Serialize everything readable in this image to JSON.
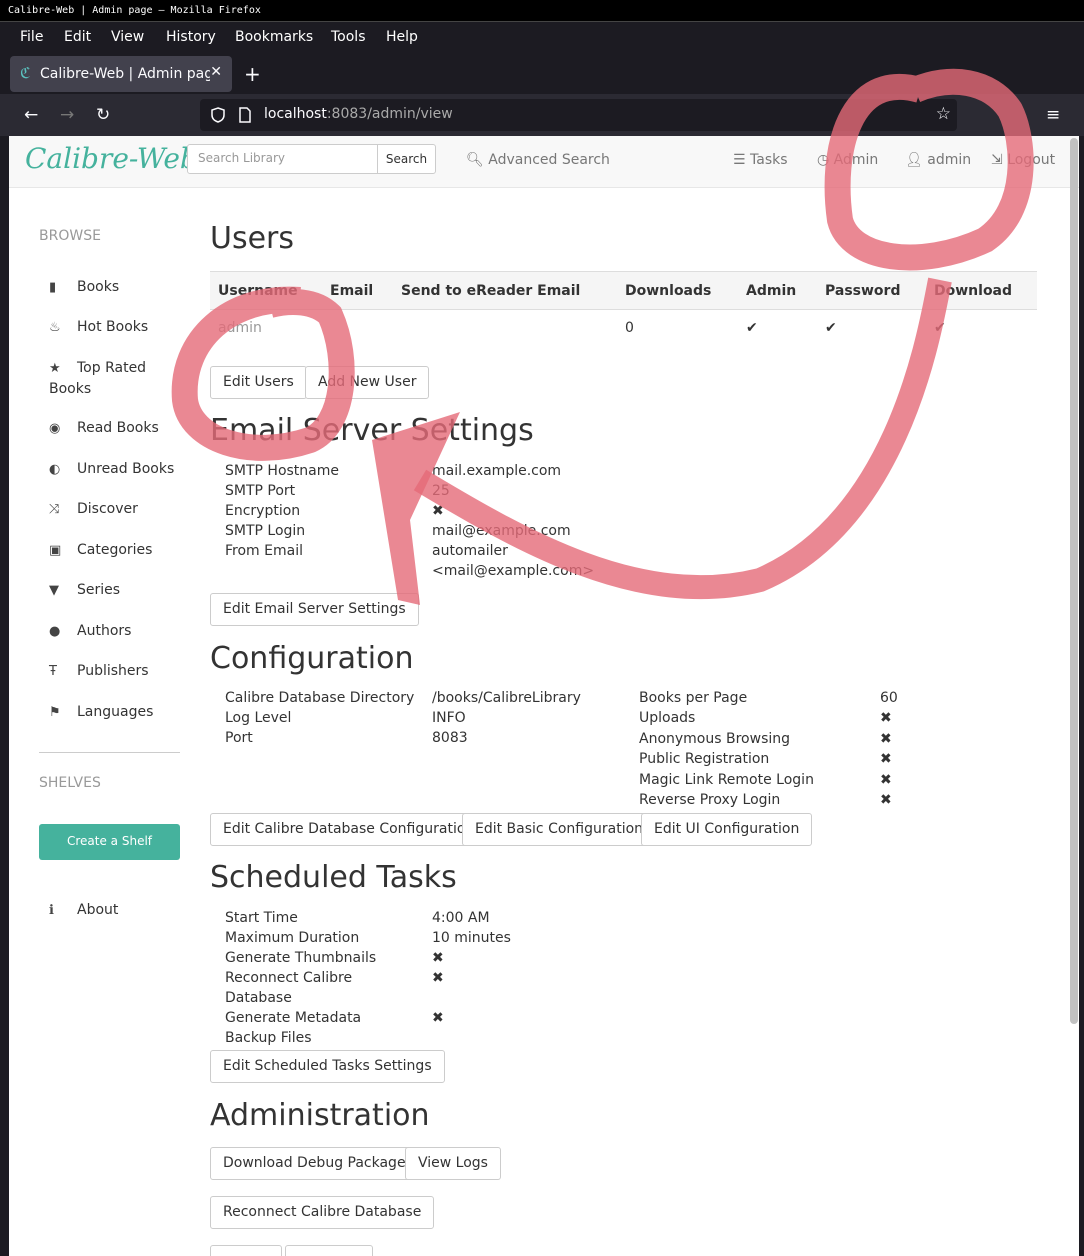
{
  "window": {
    "title": "Calibre-Web | Admin page — Mozilla Firefox"
  },
  "menu": [
    "File",
    "Edit",
    "View",
    "History",
    "Bookmarks",
    "Tools",
    "Help"
  ],
  "tab": {
    "title": "Calibre-Web | Admin page",
    "icon": "calibre-favicon-icon"
  },
  "url": {
    "host": "localhost",
    "rest": ":8083/admin/view"
  },
  "topnav": {
    "brand": "Calibre-Web",
    "search_placeholder": "Search Library",
    "search_button": "Search",
    "advanced": "Advanced Search",
    "tasks": "Tasks",
    "admin": "Admin",
    "user": "admin",
    "logout": "Logout"
  },
  "sidebar": {
    "browse": "BROWSE",
    "items": [
      {
        "label": "Books"
      },
      {
        "label": "Hot Books"
      },
      {
        "label": "Top Rated Books"
      },
      {
        "label": "Read Books"
      },
      {
        "label": "Unread Books"
      },
      {
        "label": "Discover"
      },
      {
        "label": "Categories"
      },
      {
        "label": "Series"
      },
      {
        "label": "Authors"
      },
      {
        "label": "Publishers"
      },
      {
        "label": "Languages"
      }
    ],
    "shelves": "SHELVES",
    "create_shelf": "Create a Shelf",
    "about": "About"
  },
  "users": {
    "title": "Users",
    "columns": [
      "Username",
      "Email",
      "Send to eReader Email",
      "Downloads",
      "Admin",
      "Password",
      "Download"
    ],
    "rows": [
      {
        "username": "admin",
        "email": "",
        "ereader": "",
        "downloads": "0",
        "admin": "✔",
        "password": "✔",
        "download": "✔"
      }
    ],
    "edit_users": "Edit Users",
    "add_user": "Add New User"
  },
  "email": {
    "title": "Email Server Settings",
    "rows": [
      {
        "k": "SMTP Hostname",
        "v": "mail.example.com"
      },
      {
        "k": "SMTP Port",
        "v": "25"
      },
      {
        "k": "Encryption",
        "v": "✖"
      },
      {
        "k": "SMTP Login",
        "v": "mail@example.com"
      },
      {
        "k": "From Email",
        "v": "automailer <mail@example.com>"
      }
    ],
    "edit": "Edit Email Server Settings"
  },
  "config": {
    "title": "Configuration",
    "left": [
      {
        "k": "Calibre Database Directory",
        "v": "/books/CalibreLibrary"
      },
      {
        "k": "Log Level",
        "v": "INFO"
      },
      {
        "k": "Port",
        "v": "8083"
      }
    ],
    "right": [
      {
        "k": "Books per Page",
        "v": "60"
      },
      {
        "k": "Uploads",
        "v": "✖"
      },
      {
        "k": "Anonymous Browsing",
        "v": "✖"
      },
      {
        "k": "Public Registration",
        "v": "✖"
      },
      {
        "k": "Magic Link Remote Login",
        "v": "✖"
      },
      {
        "k": "Reverse Proxy Login",
        "v": "✖"
      }
    ],
    "btn_db": "Edit Calibre Database Configuration",
    "btn_basic": "Edit Basic Configuration",
    "btn_ui": "Edit UI Configuration"
  },
  "tasks": {
    "title": "Scheduled Tasks",
    "rows": [
      {
        "k": "Start Time",
        "v": "4:00 AM"
      },
      {
        "k": "Maximum Duration",
        "v": "10 minutes"
      },
      {
        "k": "Generate Thumbnails",
        "v": "✖"
      },
      {
        "k": "Reconnect Calibre Database",
        "v": "✖"
      },
      {
        "k": "Generate Metadata Backup Files",
        "v": "✖"
      }
    ],
    "edit": "Edit Scheduled Tasks Settings"
  },
  "administration": {
    "title": "Administration",
    "debug": "Download Debug Package",
    "logs": "View Logs",
    "reconnect": "Reconnect Calibre Database"
  }
}
